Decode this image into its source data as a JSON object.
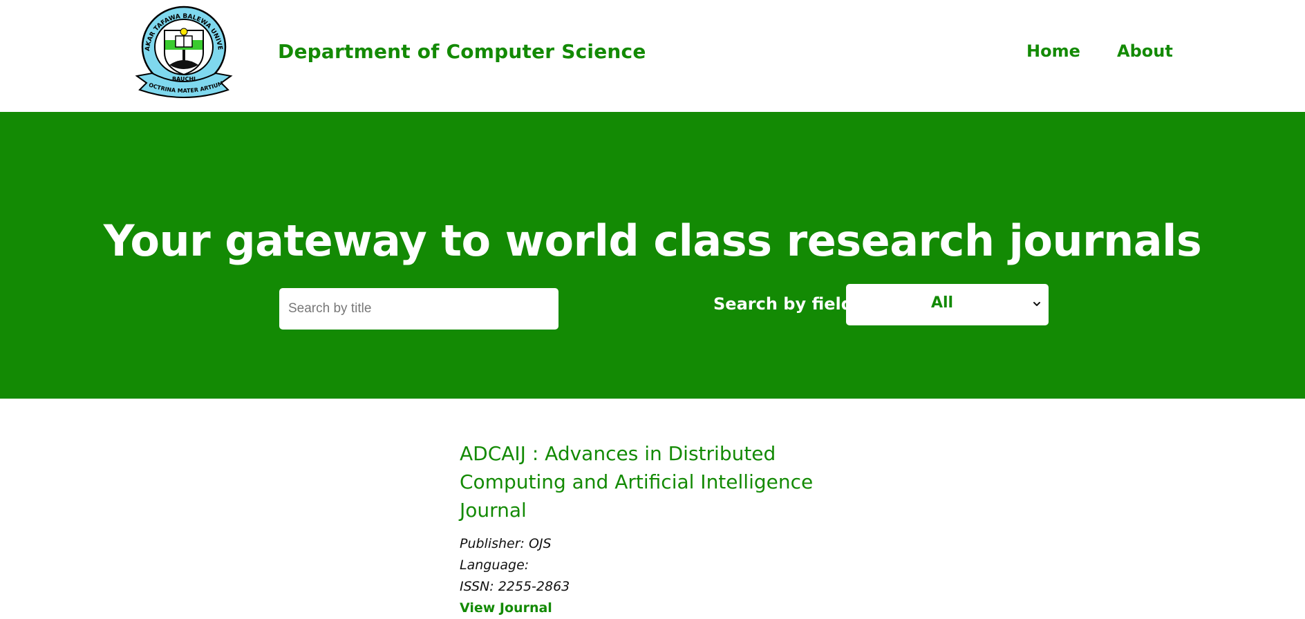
{
  "header": {
    "logo": {
      "icon": "university-crest-logo",
      "ring_text": "ABUBAKAR TAFAWA BALEWA UNIVERSITY",
      "city": "BAUCHI",
      "motto": "DOCTRINA MATER ARTIUM"
    },
    "title": "Department of Computer Science",
    "nav": {
      "home": "Home",
      "about": "About"
    }
  },
  "hero": {
    "title": "Your gateway to world class research journals",
    "search": {
      "placeholder": "Search by title",
      "value": ""
    },
    "field_label": "Search by field:",
    "field_selected": "All"
  },
  "journals": [
    {
      "title": "ADCAIJ : Advances in Distributed Computing and Artificial Intelligence Journal",
      "publisher": "Publisher: OJS",
      "language": "Language:",
      "issn": "ISSN: 2255-2863",
      "link": "View Journal"
    }
  ],
  "colors": {
    "brand_green": "#138a04",
    "white": "#ffffff"
  }
}
